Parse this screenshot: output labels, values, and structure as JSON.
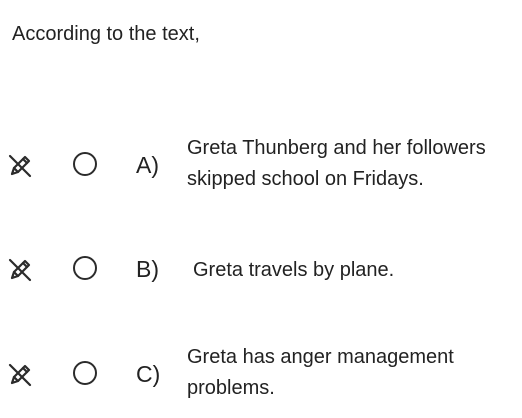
{
  "question": {
    "prompt": "According to the text,"
  },
  "options": [
    {
      "letter": "A)",
      "text": "Greta Thunberg and her followers skipped school on Fridays.",
      "eliminate_icon": "pencil-slash-icon",
      "radio_icon": "radio-empty-icon"
    },
    {
      "letter": "B)",
      "text": "Greta travels by plane.",
      "eliminate_icon": "pencil-slash-icon",
      "radio_icon": "radio-empty-icon"
    },
    {
      "letter": "C)",
      "text": "Greta has anger management problems.",
      "eliminate_icon": "pencil-slash-icon",
      "radio_icon": "radio-empty-icon"
    }
  ],
  "colors": {
    "text": "#222222",
    "background": "#ffffff"
  }
}
